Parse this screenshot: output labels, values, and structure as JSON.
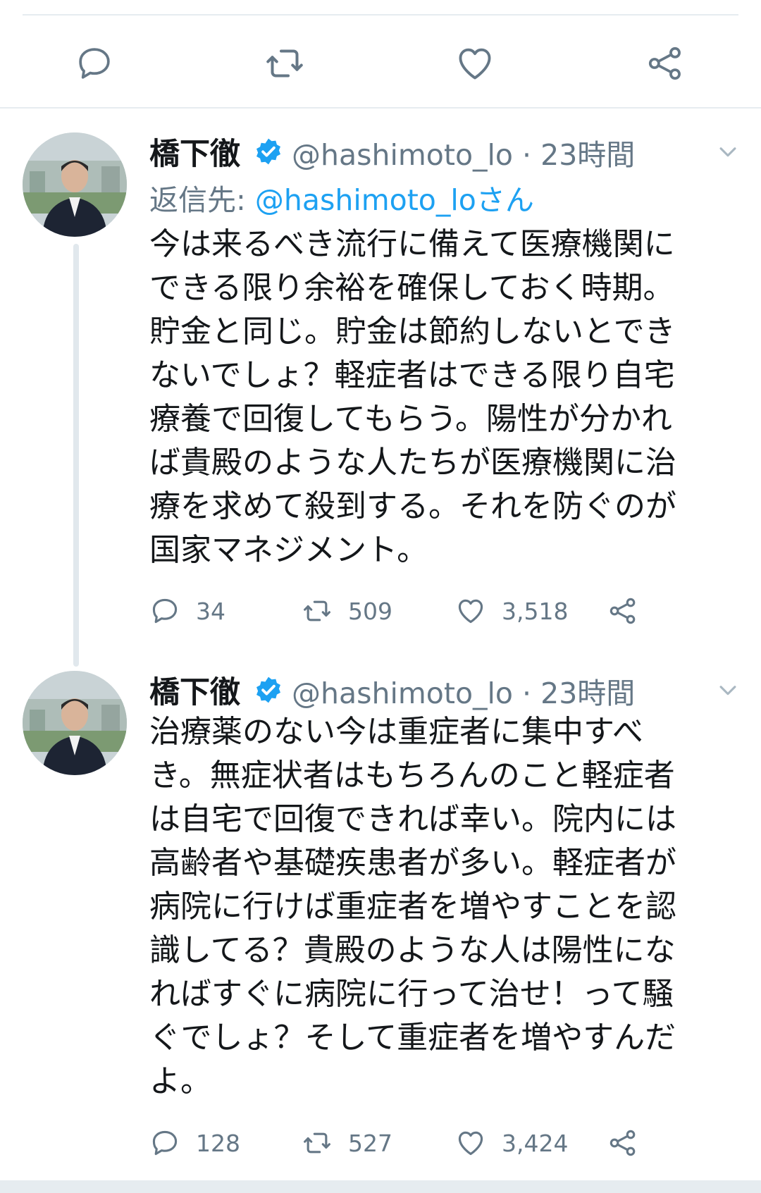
{
  "top_actions": [
    "reply",
    "retweet",
    "like",
    "share"
  ],
  "colors": {
    "accent": "#1da1f2",
    "secondary_text": "#657786",
    "icon": "#657786",
    "divider": "#e6ecf0"
  },
  "tweets": [
    {
      "name": "橋下徹",
      "handle": "@hashimoto_lo · 23時間",
      "reply_label": "返信先: ",
      "reply_mention": "@hashimoto_loさん",
      "text": "今は来るべき流行に備えて医療機関に\nできる限り余裕を確保しておく時期。\n貯金と同じ。貯金は節約しないとでき\nないでしょ？軽症者はできる限り自宅\n療養で回復してもらう。陽性が分かれ\nば貴殿のような人たちが医療機関に治\n療を求めて殺到する。それを防ぐのが\n国家マネジメント。",
      "replies": "34",
      "retweets": "509",
      "likes": "3,518"
    },
    {
      "name": "橋下徹",
      "handle": "@hashimoto_lo · 23時間",
      "text": "治療薬のない今は重症者に集中すべ\nき。無症状者はもちろんのこと軽症者\nは自宅で回復できれば幸い。院内には\n高齢者や基礎疾患者が多い。軽症者が\n病院に行けば重症者を増やすことを認\n識してる？貴殿のような人は陽性にな\nればすぐに病院に行って治せ！って騒\nぐでしょ？そして重症者を増やすんだ\nよ。",
      "replies": "128",
      "retweets": "527",
      "likes": "3,424"
    }
  ]
}
